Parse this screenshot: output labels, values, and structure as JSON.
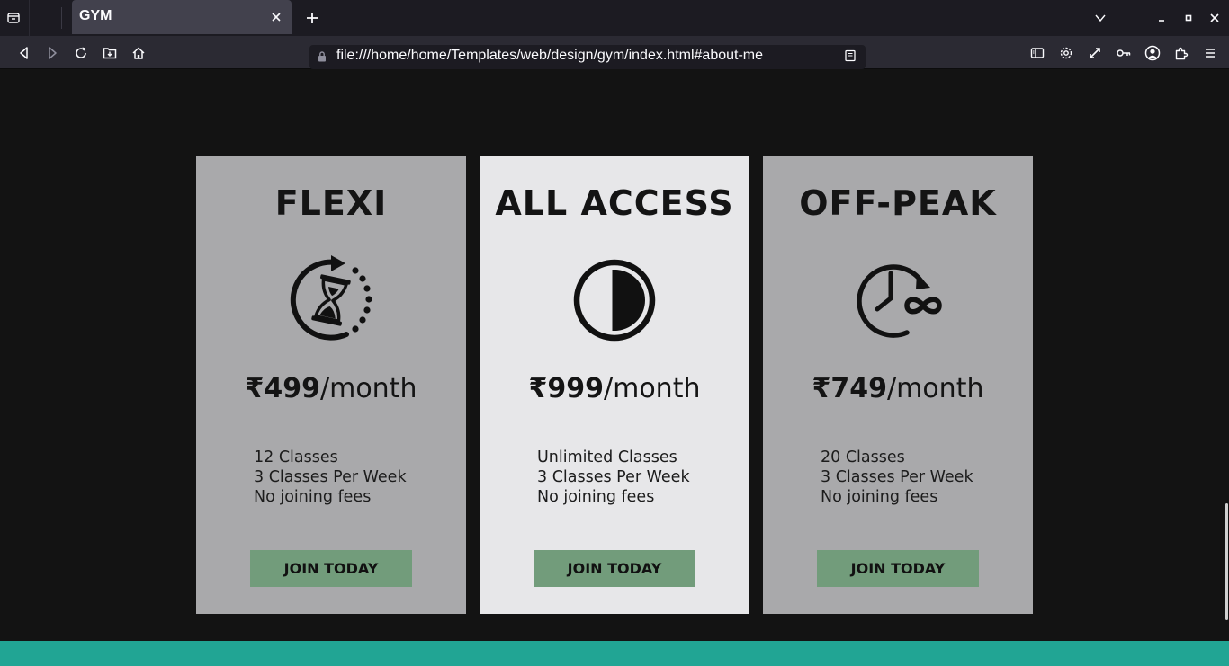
{
  "browser": {
    "tab_title": "GYM",
    "url": "file:///home/home/Templates/web/design/gym/index.html#about-me"
  },
  "plans": [
    {
      "name": "FLEXI",
      "icon": "hourglass-refresh-icon",
      "price": "₹499",
      "period": "/month",
      "features": [
        "12 Classes",
        "3 Classes Per Week",
        "No joining fees"
      ],
      "button": "JOIN TODAY",
      "featured": false
    },
    {
      "name": "ALL ACCESS",
      "icon": "half-circle-contrast-icon",
      "price": "₹999",
      "period": "/month",
      "features": [
        "Unlimited Classes",
        "3 Classes Per Week",
        "No joining fees"
      ],
      "button": "JOIN TODAY",
      "featured": true
    },
    {
      "name": "OFF-PEAK",
      "icon": "clock-infinity-icon",
      "price": "₹749",
      "period": "/month",
      "features": [
        "20 Classes",
        "3 Classes Per Week",
        "No joining fees"
      ],
      "button": "JOIN TODAY",
      "featured": false
    }
  ],
  "colors": {
    "page_bg": "#131313",
    "card_bg": "#a9a9ab",
    "card_featured_bg": "#e7e7e9",
    "button_bg": "#729c7b",
    "footer_band": "#21a594"
  }
}
